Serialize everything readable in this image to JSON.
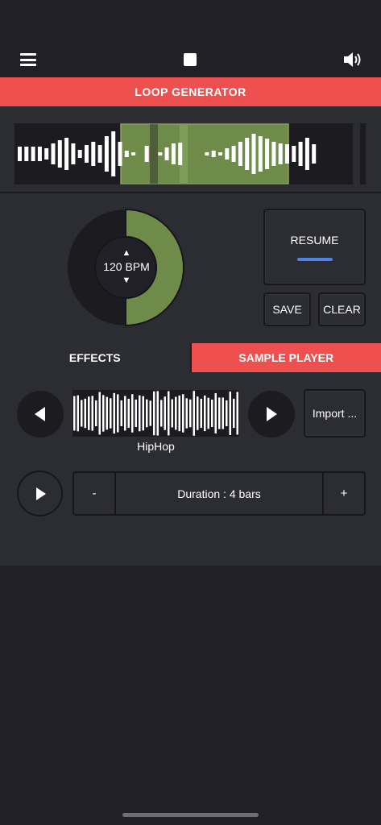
{
  "toolbar": {
    "menu_icon": "hamburger-menu-icon",
    "stop_icon": "stop-square-icon",
    "speaker_icon": "speaker-volume-icon"
  },
  "title": "LOOP GENERATOR",
  "tempo": {
    "bpm_label": "120 BPM",
    "up_glyph": "▲",
    "down_glyph": "▼",
    "knob_fill": 0.5,
    "knob_color": "#6e8b4a"
  },
  "buttons": {
    "resume": "RESUME",
    "save": "SAVE",
    "clear": "CLEAR"
  },
  "tabs": [
    {
      "label": "EFFECTS",
      "active": false
    },
    {
      "label": "SAMPLE PLAYER",
      "active": true
    }
  ],
  "sample": {
    "name": "HipHop",
    "import_label": "Import ...",
    "duration_label": "Duration : 4 bars",
    "minus": "-",
    "plus": "+"
  },
  "colors": {
    "accent": "#ee5050",
    "background": "#202026",
    "panel": "#2c2c33",
    "resume_indicator": "#4f82e6",
    "selection": "#6e8b4a"
  }
}
